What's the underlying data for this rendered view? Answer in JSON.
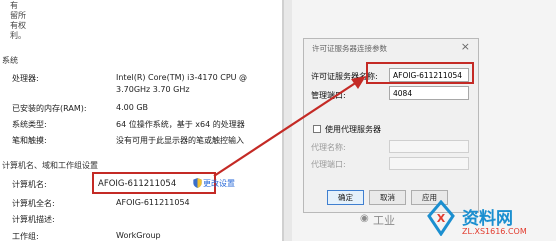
{
  "left_panel": {
    "corner_lines": [
      "有",
      "留所",
      "有权",
      "利。"
    ],
    "system_section": "系统",
    "rows": [
      {
        "label": "处理器:",
        "value_lines": [
          "Intel(R) Core(TM) i3-4170 CPU @",
          "3.70GHz   3.70 GHz"
        ]
      },
      {
        "label": "已安装的内存(RAM):",
        "value_lines": [
          "4.00 GB"
        ]
      },
      {
        "label": "系统类型:",
        "value_lines": [
          "64 位操作系统，基于 x64 的处理器"
        ]
      },
      {
        "label": "笔和触摸:",
        "value_lines": [
          "没有可用于此显示器的笔或触控输入"
        ]
      }
    ],
    "computer_section": "计算机名、域和工作组设置",
    "computer_rows": [
      {
        "label": "计算机名:",
        "value": "AFOIG-611211054"
      },
      {
        "label": "计算机全名:",
        "value": "AFOIG-611211054"
      },
      {
        "label": "计算机描述:",
        "value": ""
      },
      {
        "label": "工作组:",
        "value": "WorkGroup"
      }
    ],
    "change_settings_link": "更改设置"
  },
  "dialog": {
    "title": "许可证服务器连接参数",
    "close_symbol": "×",
    "server_name_label": "许可证服务器名称:",
    "server_name_value": "AFOIG-611211054",
    "port_label": "管理端口:",
    "port_value": "4084",
    "use_proxy_label": "使用代理服务器",
    "proxy_name_label": "代理名称:",
    "proxy_port_label": "代理端口:",
    "buttons": {
      "ok": "确定",
      "cancel": "取消",
      "apply": "应用"
    }
  },
  "watermark": {
    "left_text": "工业",
    "brand": "资料网",
    "url": "ZL.XS1616.COM"
  },
  "colors": {
    "highlight_red": "#c42a25",
    "link_blue": "#2a6ad8",
    "watermark_blue": "#1b8fd0",
    "watermark_red": "#e23b2e"
  }
}
